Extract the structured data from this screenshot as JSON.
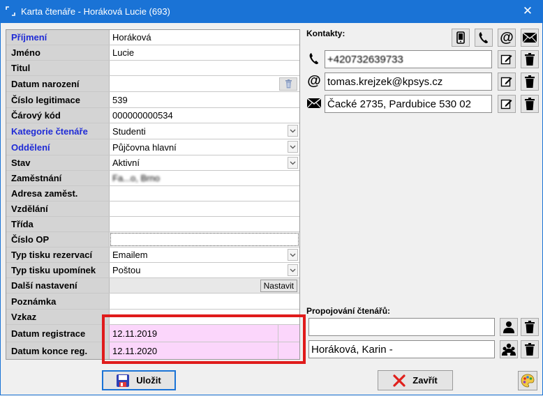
{
  "window": {
    "title": "Karta čtenáře - Horáková Lucie (693)",
    "close_glyph": "✕"
  },
  "form": {
    "rows": [
      {
        "label": "Příjmení",
        "value": "Horáková",
        "label_blue": true
      },
      {
        "label": "Jméno",
        "value": "Lucie"
      },
      {
        "label": "Titul",
        "value": ""
      },
      {
        "label": "Datum narození",
        "value": ""
      },
      {
        "label": "Číslo legitimace",
        "value": "539"
      },
      {
        "label": "Čárový kód",
        "value": "000000000534"
      },
      {
        "label": "Kategorie čtenáře",
        "value": "Studenti",
        "label_blue": true
      },
      {
        "label": "Oddělení",
        "value": "Půjčovna hlavní",
        "label_blue": true
      },
      {
        "label": "Stav",
        "value": "Aktivní"
      },
      {
        "label": "Zaměstnání",
        "value": "Fa...o, Brno"
      },
      {
        "label": "Adresa zaměst.",
        "value": ""
      },
      {
        "label": "Vzdělání",
        "value": ""
      },
      {
        "label": "Třída",
        "value": ""
      },
      {
        "label": "Číslo OP",
        "value": ""
      },
      {
        "label": "Typ tisku rezervací",
        "value": "Emailem"
      },
      {
        "label": "Typ tisku upomínek",
        "value": "Poštou"
      },
      {
        "label": "Další nastavení",
        "value": ""
      },
      {
        "label": "Poznámka",
        "value": ""
      },
      {
        "label": "Vzkaz",
        "value": ""
      },
      {
        "label": "Datum registrace",
        "value": "12.11.2019"
      },
      {
        "label": "Datum konce reg.",
        "value": "12.11.2020"
      }
    ],
    "nastavit_label": "Nastavit"
  },
  "contacts": {
    "label": "Kontakty:",
    "phone": "+420732639733",
    "email": "tomas.krejzek@kpsys.cz",
    "address": "Čacké 2735, Pardubice 530 02"
  },
  "linking": {
    "label": "Propojování čtenářů:",
    "field1": "",
    "field2": "Horáková, Karin -"
  },
  "buttons": {
    "save": "Uložit",
    "close": "Zavřít"
  },
  "colors": {
    "titlebar": "#1a73d6",
    "label_blue": "#1f2bd6",
    "highlight_pink": "#fbd6fb",
    "red_frame": "#e01b1b"
  }
}
